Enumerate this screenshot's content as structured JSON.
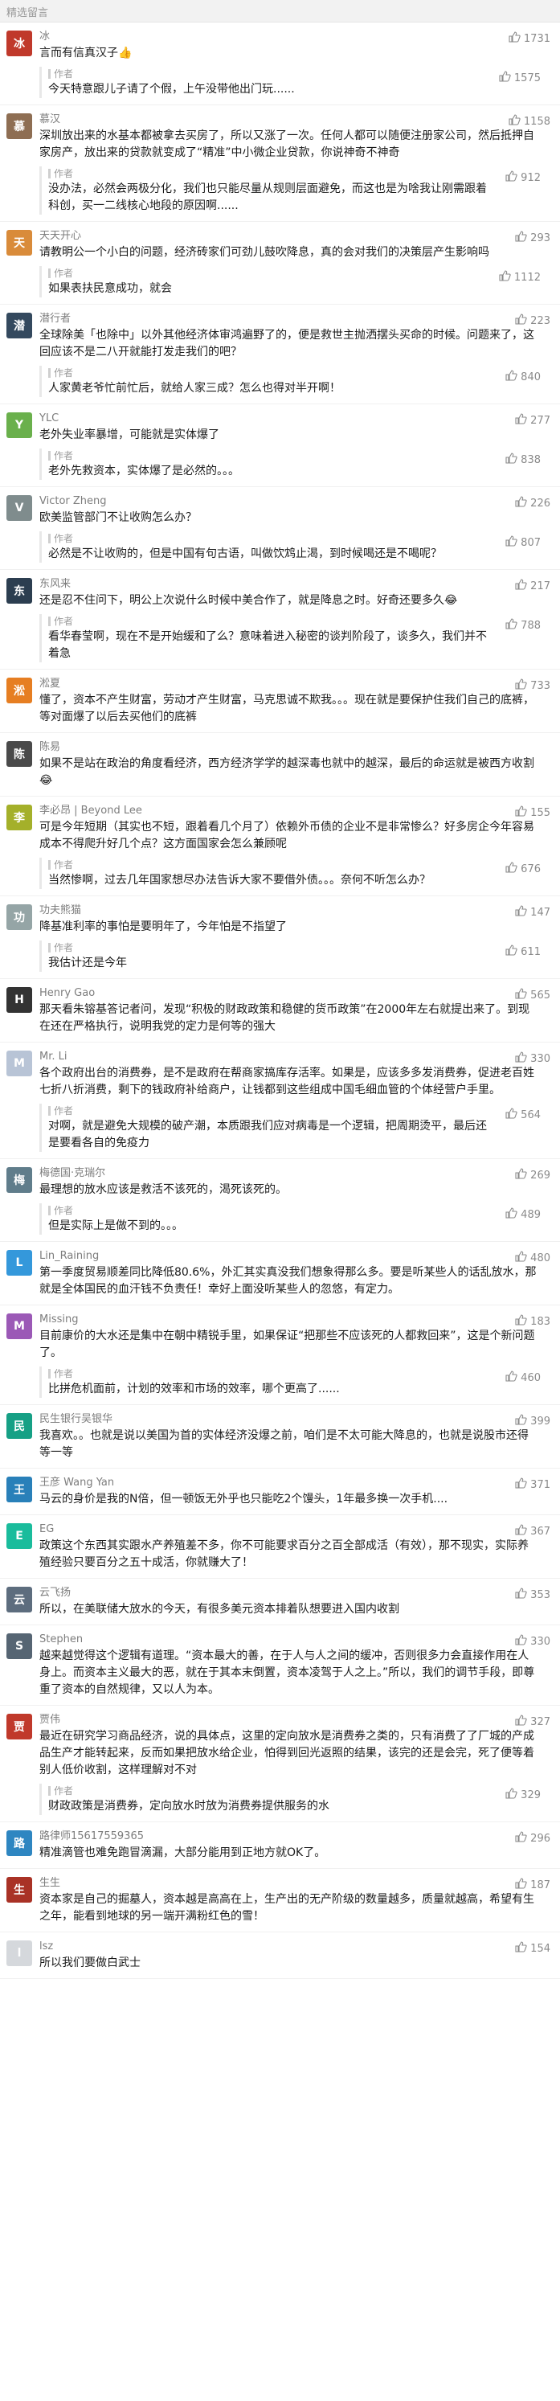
{
  "section_title": "精选留言",
  "author_label": "作者",
  "comments": [
    {
      "name": "冰",
      "text": "言而有信真汉子👍",
      "likes": "1731",
      "avatar_color": "#c0392b",
      "initial": "冰",
      "reply": {
        "text": "今天特意跟儿子请了个假，上午没带他出门玩......",
        "likes": "1575"
      }
    },
    {
      "name": "慕汉",
      "text": "深圳放出来的水基本都被拿去买房了，所以又涨了一次。任何人都可以随便注册家公司，然后抵押自家房产，放出来的贷款就变成了“精准”中小微企业贷款，你说神奇不神奇",
      "likes": "1158",
      "avatar_color": "#8e6e53",
      "initial": "慕",
      "reply": {
        "text": "没办法，必然会两极分化，我们也只能尽量从规则层面避免，而这也是为啥我让刚需跟着科创，买一二线核心地段的原因啊......",
        "likes": "912"
      }
    },
    {
      "name": "天天开心",
      "text": "请教明公一个小白的问题，经济砖家们可劲儿鼓吹降息，真的会对我们的决策层产生影响吗",
      "likes": "293",
      "avatar_color": "#d98b3a",
      "initial": "天",
      "reply": {
        "text": "如果表扶民意成功，就会",
        "likes": "1112"
      }
    },
    {
      "name": "潜行者",
      "text": "全球除美「也除中」以外其他经济体审鸿遍野了的，便是救世主抛洒摆头买命的时候。问题来了，这回应该不是二八开就能打发走我们的吧？",
      "likes": "223",
      "avatar_color": "#34495e",
      "initial": "潜",
      "reply": {
        "text": "人家黄老爷忙前忙后，就给人家三成？怎么也得对半开啊！",
        "likes": "840"
      }
    },
    {
      "name": "YLC",
      "text": "老外失业率暴增，可能就是实体爆了",
      "likes": "277",
      "avatar_color": "#6ab04c",
      "initial": "Y",
      "reply": {
        "text": "老外先救资本，实体爆了是必然的。。。",
        "likes": "838"
      }
    },
    {
      "name": "Victor Zheng",
      "text": "欧美监管部门不让收购怎么办？",
      "likes": "226",
      "avatar_color": "#7f8c8d",
      "initial": "V",
      "reply": {
        "text": "必然是不让收购的，但是中国有句古语，叫做饮鸩止渴，到时候喝还是不喝呢？",
        "likes": "807"
      }
    },
    {
      "name": "东风来",
      "text": "还是忍不住问下，明公上次说什么时候中美合作了，就是降息之时。好奇还要多久😂",
      "likes": "217",
      "avatar_color": "#2c3e50",
      "initial": "东",
      "reply": {
        "text": "看华春莹啊，现在不是开始缓和了么？意味着进入秘密的谈判阶段了，谈多久，我们并不着急",
        "likes": "788"
      }
    },
    {
      "name": "淞夏",
      "text": "懂了，资本不产生财富，劳动才产生财富，马克思诚不欺我。。。现在就是要保护住我们自己的底裤，等对面爆了以后去买他们的底裤",
      "likes": "733",
      "avatar_color": "#e67e22",
      "initial": "淞",
      "reply": null
    },
    {
      "name": "陈易",
      "text": "如果不是站在政治的角度看经济，西方经济学学的越深毒也就中的越深，最后的命运就是被西方收割😂",
      "likes": "",
      "avatar_color": "#4a4a4a",
      "initial": "陈",
      "reply": null
    },
    {
      "name": "李必昂 | Beyond Lee",
      "text": "可是今年短期（其实也不短，跟着看几个月了）依赖外币债的企业不是非常惨么？好多房企今年容易成本不得爬升好几个点？这方面国家会怎么兼顾呢",
      "likes": "155",
      "avatar_color": "#a4b02a",
      "initial": "李",
      "reply": {
        "text": "当然惨啊，过去几年国家想尽办法告诉大家不要借外债。。。奈何不听怎么办？",
        "likes": "676"
      }
    },
    {
      "name": "功夫熊猫",
      "text": "降基准利率的事怕是要明年了，今年怕是不指望了",
      "likes": "147",
      "avatar_color": "#95a5a6",
      "initial": "功",
      "reply": {
        "text": "我估计还是今年",
        "likes": "611"
      }
    },
    {
      "name": "Henry Gao",
      "text": "那天看朱镕基答记者问，发现“积极的财政政策和稳健的货币政策”在2000年左右就提出来了。到现在还在严格执行，说明我党的定力是何等的强大",
      "likes": "565",
      "avatar_color": "#333333",
      "initial": "H",
      "reply": null
    },
    {
      "name": "Mr. Li",
      "text": "各个政府出台的消费券，是不是政府在帮商家搞库存活率。如果是，应该多多发消费券，促进老百姓七折八折消费，剩下的钱政府补给商户，让钱都到这些组成中国毛细血管的个体经营户手里。",
      "likes": "330",
      "avatar_color": "#b8c4d6",
      "initial": "M",
      "reply": {
        "text": "对啊，就是避免大规模的破产潮，本质跟我们应对病毒是一个逻辑，把周期烫平，最后还是要看各自的免疫力",
        "likes": "564"
      }
    },
    {
      "name": "梅德国·克瑞尔",
      "text": "最理想的放水应该是救活不该死的，渴死该死的。",
      "likes": "269",
      "avatar_color": "#607d8b",
      "initial": "梅",
      "reply": {
        "text": "但是实际上是做不到的。。。",
        "likes": "489"
      }
    },
    {
      "name": "Lin_Raining",
      "text": "第一季度贸易顺差同比降低80.6%，外汇其实真没我们想象得那么多。要是听某些人的话乱放水，那就是全体国民的血汗钱不负责任！幸好上面没听某些人的忽悠，有定力。",
      "likes": "480",
      "avatar_color": "#3498db",
      "initial": "L",
      "reply": null
    },
    {
      "name": "Missing",
      "text": "目前康价的大水还是集中在朝中精锐手里，如果保证“把那些不应该死的人都救回来”，这是个新问题了。",
      "likes": "183",
      "avatar_color": "#9b59b6",
      "initial": "M",
      "reply": {
        "text": "比拼危机面前，计划的效率和市场的效率，哪个更高了......",
        "likes": "460"
      }
    },
    {
      "name": "民生银行吴银华",
      "text": "我喜欢。。也就是说以美国为首的实体经济没爆之前，咱们是不太可能大降息的，也就是说股市还得等一等",
      "likes": "399",
      "avatar_color": "#16a085",
      "initial": "民",
      "reply": null
    },
    {
      "name": "王彦 Wang Yan",
      "text": "马云的身价是我的N倍，但一顿饭无外乎也只能吃2个馒头，1年最多换一次手机....",
      "likes": "371",
      "avatar_color": "#2980b9",
      "initial": "王",
      "reply": null
    },
    {
      "name": "EG",
      "text": "政策这个东西其实跟水产养殖差不多，你不可能要求百分之百全部成活（有效），那不现实，实际养殖经验只要百分之五十成活，你就赚大了！",
      "likes": "367",
      "avatar_color": "#1abc9c",
      "initial": "E",
      "reply": null
    },
    {
      "name": "云飞扬",
      "text": "所以，在美联储大放水的今天，有很多美元资本排着队想要进入国内收割",
      "likes": "353",
      "avatar_color": "#5d6d7e",
      "initial": "云",
      "reply": null
    },
    {
      "name": "Stephen",
      "text": "越来越觉得这个逻辑有道理。“资本最大的善，在于人与人之间的缓冲，否则很多力会直接作用在人身上。而资本主义最大的恶，就在于其本末倒置，资本凌驾于人之上。”所以，我们的调节手段，即尊重了资本的自然规律，又以人为本。",
      "likes": "330",
      "avatar_color": "#566573",
      "initial": "S",
      "reply": null
    },
    {
      "name": "贾伟",
      "text": "最近在研究学习商品经济，说的具体点，这里的定向放水是消费券之类的，只有消费了了厂城的产成品生产才能转起来，反而如果把放水给企业，怕得到回光返照的结果，该完的还是会完，死了便等着别人低价收割，这样理解对不对",
      "likes": "327",
      "avatar_color": "#c0392b",
      "initial": "贾",
      "reply": {
        "text": "财政政策是消费券，定向放水时放为消费券提供服务的水",
        "likes": "329"
      }
    },
    {
      "name": "路律师15617559365",
      "text": "精准滴管也难免跑冒滴漏，大部分能用到正地方就OK了。",
      "likes": "296",
      "avatar_color": "#2e86c1",
      "initial": "路",
      "reply": null
    },
    {
      "name": "生生",
      "text": "资本家是自己的掘墓人，资本越是高高在上，生产出的无产阶级的数量越多，质量就越高，希望有生之年，能看到地球的另一端开满粉红色的雪！",
      "likes": "187",
      "avatar_color": "#a93226",
      "initial": "生",
      "reply": null
    },
    {
      "name": "lsz",
      "text": "所以我们要做白武士",
      "likes": "154",
      "avatar_color": "#d5d8dc",
      "initial": "l",
      "reply": null
    }
  ]
}
